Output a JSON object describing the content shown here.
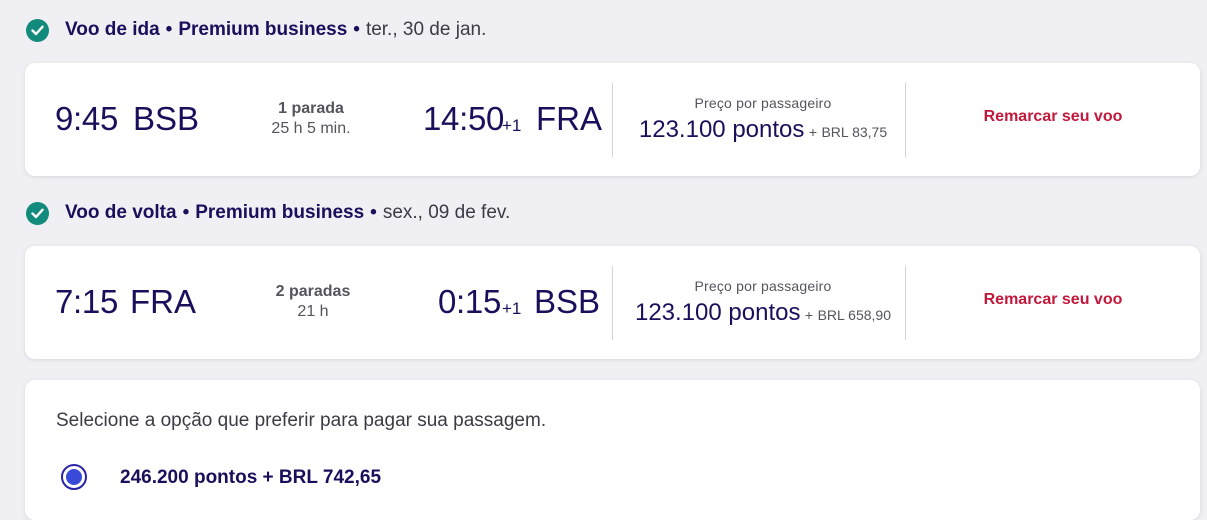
{
  "outbound": {
    "header": {
      "title": "Voo de ida",
      "separator": "•",
      "cabin": "Premium business",
      "separator2": "•",
      "date": "ter., 30 de jan."
    },
    "departure_time": "9:45",
    "departure_airport": "BSB",
    "stops": "1 parada",
    "duration": "25 h 5 min.",
    "arrival_time": "14:50",
    "arrival_day_offset": "+1",
    "arrival_airport": "FRA",
    "price_label": "Preço por passageiro",
    "points": "123.100 pontos",
    "plus": "+",
    "brl": "BRL 83,75",
    "rebook_label": "Remarcar seu voo"
  },
  "return": {
    "header": {
      "title": "Voo de volta",
      "separator": "•",
      "cabin": "Premium business",
      "separator2": "•",
      "date": "sex., 09 de fev."
    },
    "departure_time": "7:15",
    "departure_airport": "FRA",
    "stops": "2 paradas",
    "duration": "21 h",
    "arrival_time": "0:15",
    "arrival_day_offset": "+1",
    "arrival_airport": "BSB",
    "price_label": "Preço por passageiro",
    "points": "123.100 pontos",
    "plus": "+",
    "brl": "BRL 658,90",
    "rebook_label": "Remarcar seu voo"
  },
  "payment": {
    "prompt": "Selecione a opção que preferir para pagar sua passagem.",
    "option_label": "246.200 pontos + BRL 742,65",
    "option_selected": true
  },
  "colors": {
    "accent_green": "#128a7c",
    "brand_navy": "#1b0f5c",
    "link_red": "#c2183b",
    "radio_blue": "#3a4ad8"
  },
  "icons": {
    "section_check": "check-circle-icon"
  }
}
